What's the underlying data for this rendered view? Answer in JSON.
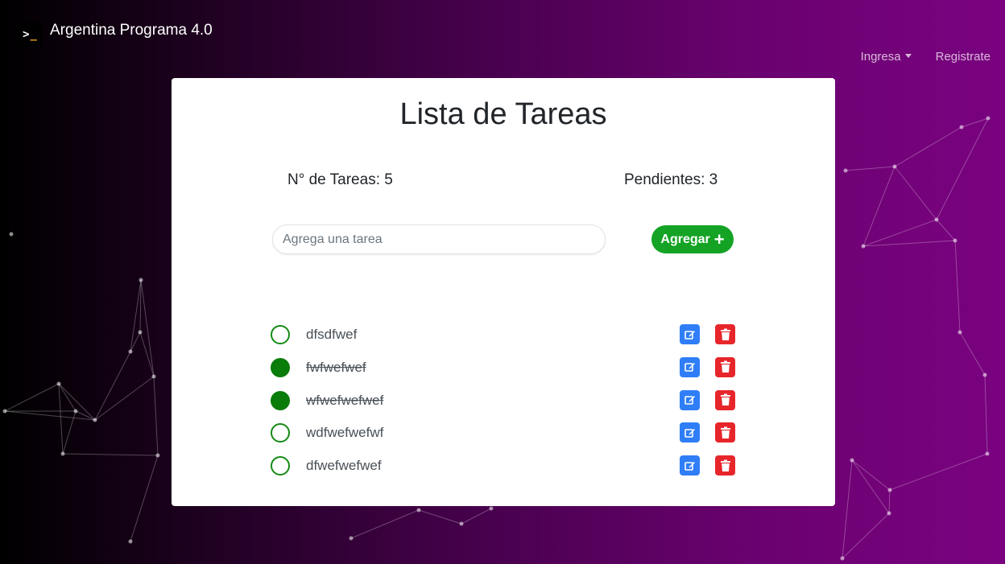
{
  "navbar": {
    "brand_logo": ">_",
    "brand_name": "Argentina Programa 4.0",
    "login_label": "Ingresa",
    "register_label": "Registrate"
  },
  "card": {
    "title": "Lista de Tareas",
    "total_label": "N° de Tareas: 5",
    "pending_label": "Pendientes: 3",
    "input_placeholder": "Agrega una tarea",
    "input_value": "",
    "add_label": "Agregar"
  },
  "tasks": [
    {
      "text": "dfsdfwef",
      "done": false
    },
    {
      "text": "fwfwefwef",
      "done": true
    },
    {
      "text": "wfwefwefwef",
      "done": true
    },
    {
      "text": "wdfwefwefwf",
      "done": false
    },
    {
      "text": "dfwefwefwef",
      "done": false
    }
  ],
  "icons": {
    "logo": "terminal-icon",
    "caret": "caret-down-icon",
    "add": "plus-icon",
    "edit": "edit-icon",
    "delete": "trash-icon",
    "check": "circle-check-icon"
  },
  "colors": {
    "add_button": "#14a325",
    "edit_button": "#2f7ef7",
    "delete_button": "#e7262b",
    "check_done": "#0a7c0a",
    "check_border": "#138a13"
  }
}
